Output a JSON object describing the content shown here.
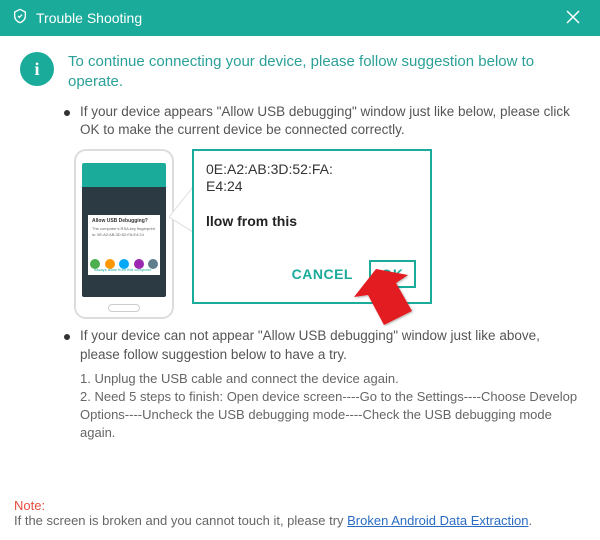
{
  "titlebar": {
    "title": "Trouble Shooting"
  },
  "intro": "To continue connecting your device, please follow suggestion below to operate.",
  "bullet1": "If your device appears \"Allow USB debugging\" window just like below, please click OK to make the current device  be connected correctly.",
  "dialog": {
    "mac_line1": "0E:A2:AB:3D:52:FA:",
    "mac_line2": "E4:24",
    "allow": "llow from this",
    "cancel": "CANCEL",
    "ok": "OK"
  },
  "popup": {
    "title": "Allow USB Debugging?",
    "body": "The computer's RSA key fingerprint is: 0E:A2:AB:3D:52:FA:E4:24",
    "check": "Always allow from this computer",
    "cancel": "CANCEL",
    "ok": "OK"
  },
  "bullet2": "If your device can not appear \"Allow USB debugging\" window just like above, please follow suggestion below to have a try.",
  "step1": "1. Unplug the USB cable and connect the device again.",
  "step2": "2. Need 5 steps to finish: Open device screen----Go to the Settings----Choose Develop Options----Uncheck the USB debugging mode----Check the USB debugging mode again.",
  "note": {
    "label": "Note:",
    "text": "If the screen is broken and you cannot touch it, please try ",
    "link": "Broken Android Data Extraction"
  }
}
